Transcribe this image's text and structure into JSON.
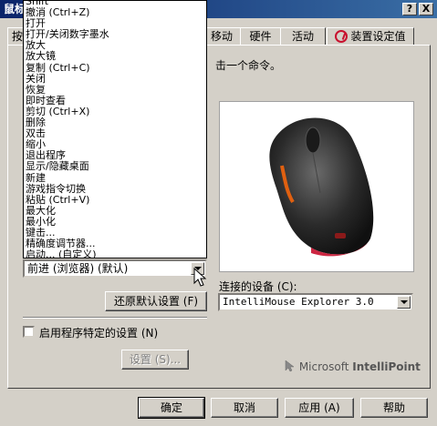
{
  "window": {
    "title": "鼠标",
    "help_button": "?",
    "close_button": "X"
  },
  "tabs": [
    {
      "label": "按"
    },
    {
      "label": "移动"
    },
    {
      "label": "硬件"
    },
    {
      "label": "活动"
    },
    {
      "label": "装置设定值"
    }
  ],
  "instruction": "击一个命令。",
  "command_list": [
    "Shift",
    "撤消 (Ctrl+Z)",
    "打开",
    "打开/关闭数字墨水",
    "放大",
    "放大镜",
    "复制 (Ctrl+C)",
    "关闭",
    "恢复",
    "即时查看",
    "剪切 (Ctrl+X)",
    "删除",
    "双击",
    "缩小",
    "退出程序",
    "显示/隐藏桌面",
    "新建",
    "游戏指令切换",
    "粘贴 (Ctrl+V)",
    "最大化",
    "最小化",
    "键击...",
    "精确度调节器...",
    "启动...    (自定义)"
  ],
  "command_select": {
    "value": "前进 (浏览器)  (默认)"
  },
  "restore_defaults_button": "还原默认设置 (F)",
  "connected_device": {
    "label": "连接的设备 (C):",
    "value": "IntelliMouse Explorer 3.0"
  },
  "app_specific": {
    "label": "启用程序特定的设置 (N)",
    "checked": false
  },
  "settings_button": "设置 (S)...",
  "branding": {
    "company": "Microsoft",
    "product": "IntelliPoint"
  },
  "footer": {
    "ok": "确定",
    "cancel": "取消",
    "apply": "应用 (A)",
    "help": "帮助"
  },
  "colors": {
    "titlebar_start": "#0a246a",
    "titlebar_end": "#3a6ea5",
    "face": "#d4d0c8",
    "logo_red": "#c8102e"
  }
}
